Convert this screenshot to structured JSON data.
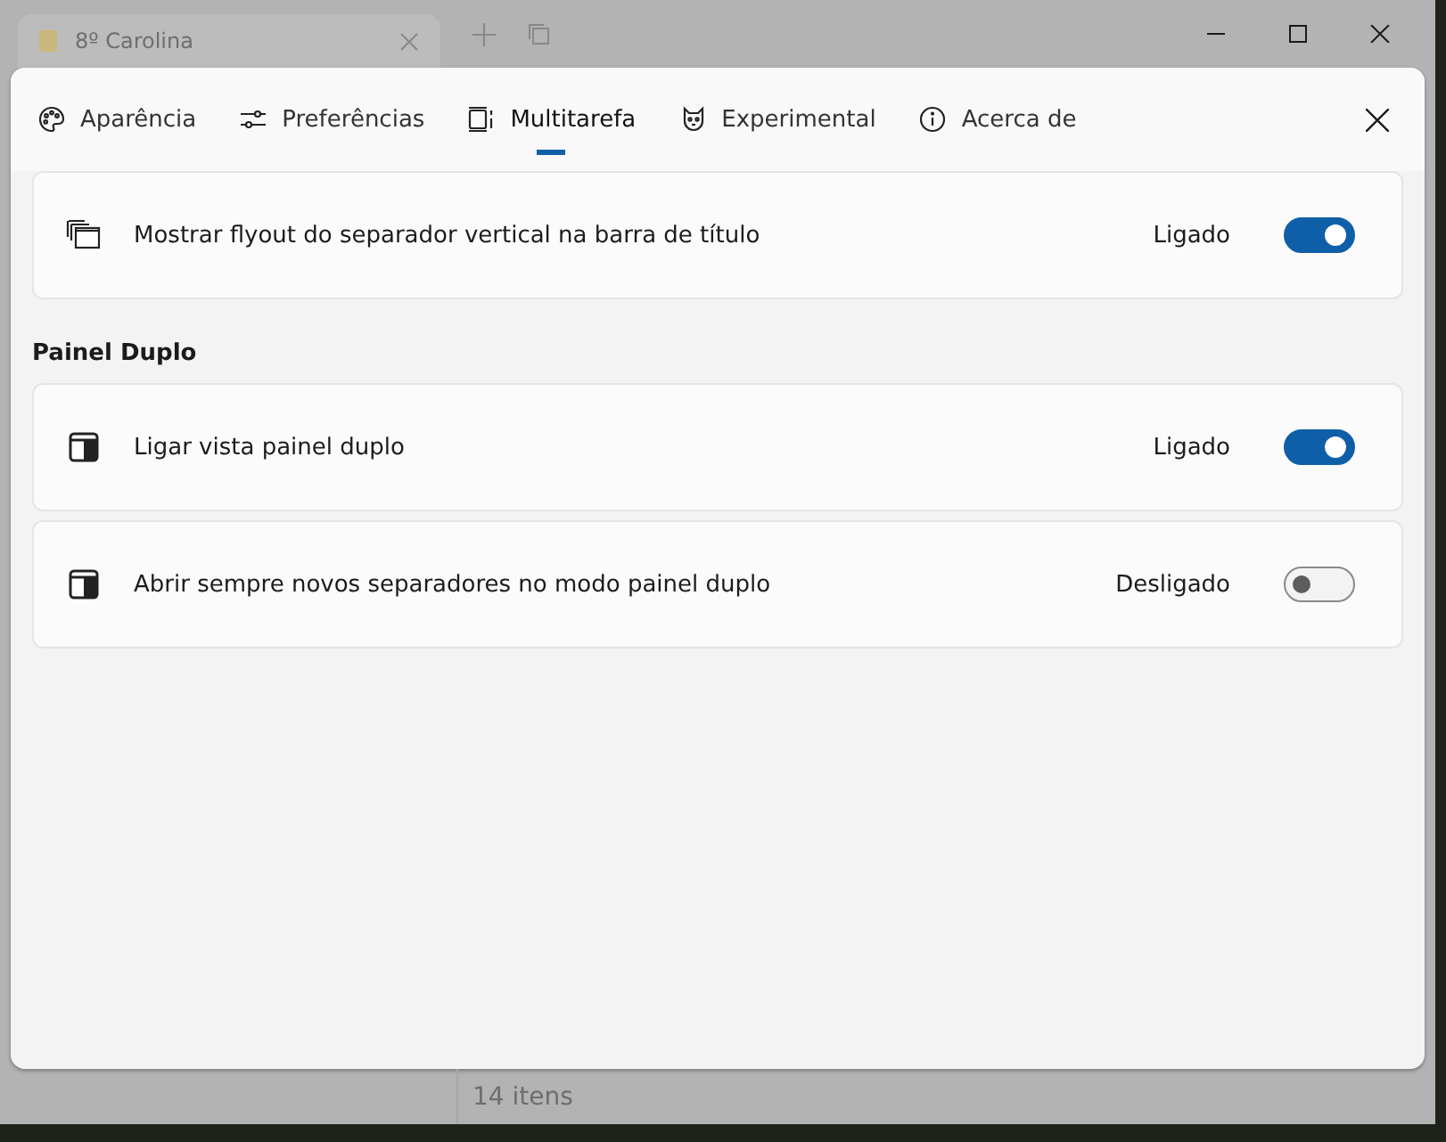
{
  "window": {
    "tab_title": "8º Carolina",
    "status_bar": "14 itens"
  },
  "dialog": {
    "tabs": [
      {
        "label": "Aparência",
        "selected": false
      },
      {
        "label": "Preferências",
        "selected": false
      },
      {
        "label": "Multitarefa",
        "selected": true
      },
      {
        "label": "Experimental",
        "selected": false
      },
      {
        "label": "Acerca de",
        "selected": false
      }
    ],
    "sections": [
      {
        "items": [
          {
            "label": "Mostrar flyout do separador vertical na barra de título",
            "state": "Ligado",
            "on": true
          }
        ]
      },
      {
        "heading": "Painel Duplo",
        "items": [
          {
            "label": "Ligar vista painel duplo",
            "state": "Ligado",
            "on": true
          },
          {
            "label": "Abrir sempre novos separadores no modo painel duplo",
            "state": "Desligado",
            "on": false
          }
        ]
      }
    ]
  }
}
